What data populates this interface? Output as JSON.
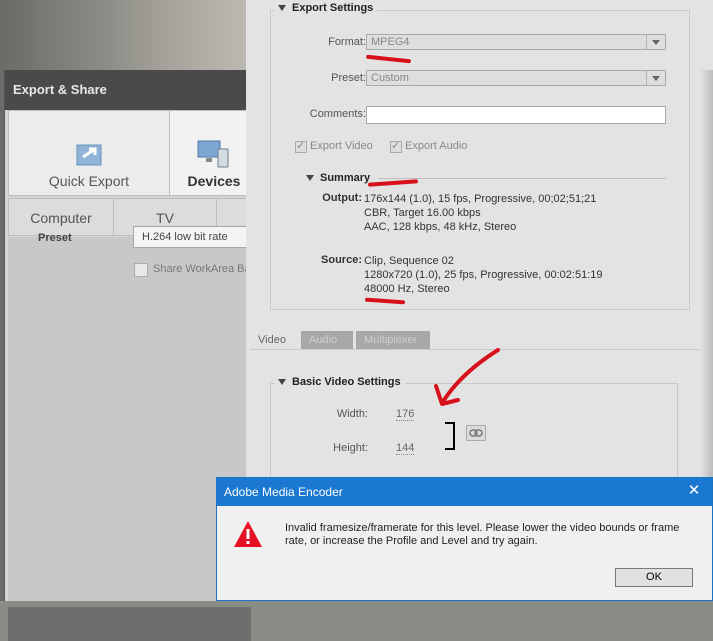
{
  "export_share": {
    "title": "Export & Share",
    "tabs": [
      "Quick Export",
      "Devices"
    ],
    "sub_tabs": [
      "Computer",
      "TV"
    ],
    "preset_label": "Preset",
    "preset_value": "H.264 low bit rate",
    "share_workarea_label": "Share WorkArea Ba"
  },
  "export_settings": {
    "title": "Export Settings",
    "format_label": "Format:",
    "format_value": "MPEG4",
    "preset_label": "Preset:",
    "preset_value": "Custom",
    "comments_label": "Comments:",
    "export_video_label": "Export Video",
    "export_audio_label": "Export Audio",
    "summary_title": "Summary",
    "output_label": "Output:",
    "output_lines": [
      "176x144 (1.0), 15 fps, Progressive, 00;02;51;21",
      "CBR, Target 16.00 kbps",
      "AAC, 128 kbps, 48 kHz, Stereo"
    ],
    "source_label": "Source:",
    "source_lines": [
      "Clip, Sequence 02",
      "1280x720 (1.0), 25 fps, Progressive, 00:02:51:19",
      "48000 Hz, Stereo"
    ]
  },
  "lower_tabs": [
    "Video",
    "Audio",
    "Multiplexer"
  ],
  "basic_video": {
    "title": "Basic Video Settings",
    "width_label": "Width:",
    "width_value": "176",
    "height_label": "Height:",
    "height_value": "144"
  },
  "dialog": {
    "title": "Adobe Media Encoder",
    "message": "Invalid framesize/framerate for this level. Please lower the video bounds or frame rate, or increase the Profile and Level and try again.",
    "ok_label": "OK",
    "close_glyph": "✕"
  },
  "colors": {
    "annotation_red": "#d6111b",
    "dialog_title_blue": "#1b78d0",
    "warning_red": "#e81123"
  }
}
